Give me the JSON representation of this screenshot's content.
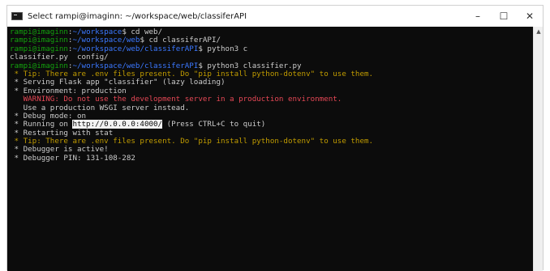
{
  "window": {
    "title": "Select rampi@imaginn: ~/workspace/web/classiferAPI",
    "minimize": "–",
    "maximize": "☐",
    "close": "✕"
  },
  "scrollbar": {
    "up_arrow": "▲"
  },
  "terminal": {
    "lines": [
      [
        {
          "t": "rampi@imaginn",
          "c": "green"
        },
        {
          "t": ":",
          "c": "white"
        },
        {
          "t": "~/workspace",
          "c": "blue"
        },
        {
          "t": "$ cd web/",
          "c": "white"
        }
      ],
      [
        {
          "t": "rampi@imaginn",
          "c": "green"
        },
        {
          "t": ":",
          "c": "white"
        },
        {
          "t": "~/workspace/web",
          "c": "blue"
        },
        {
          "t": "$ cd classiferAPI/",
          "c": "white"
        }
      ],
      [
        {
          "t": "rampi@imaginn",
          "c": "green"
        },
        {
          "t": ":",
          "c": "white"
        },
        {
          "t": "~/workspace/web/classiferAPI",
          "c": "blue"
        },
        {
          "t": "$ python3 c",
          "c": "white"
        }
      ],
      [
        {
          "t": "classifier.py  config/",
          "c": "white"
        }
      ],
      [
        {
          "t": "rampi@imaginn",
          "c": "green"
        },
        {
          "t": ":",
          "c": "white"
        },
        {
          "t": "~/workspace/web/classiferAPI",
          "c": "blue"
        },
        {
          "t": "$ python3 classifier.py",
          "c": "white"
        }
      ],
      [
        {
          "t": " * Tip: There are .env files present. Do \"pip install python-dotenv\" to use them.",
          "c": "yellow"
        }
      ],
      [
        {
          "t": " * Serving Flask app \"classifier\" (lazy loading)",
          "c": "white"
        }
      ],
      [
        {
          "t": " * Environment: production",
          "c": "white"
        }
      ],
      [
        {
          "t": "   WARNING: Do not use the development server in a production environment.",
          "c": "red"
        }
      ],
      [
        {
          "t": "   Use a production WSGI server instead.",
          "c": "white"
        }
      ],
      [
        {
          "t": " * Debug mode: on",
          "c": "white"
        }
      ],
      [
        {
          "t": " * Running on ",
          "c": "white"
        },
        {
          "t": "http://0.0.0.0:4000/",
          "c": "hl"
        },
        {
          "t": " (Press CTRL+C to quit)",
          "c": "white"
        }
      ],
      [
        {
          "t": " * Restarting with stat",
          "c": "white"
        }
      ],
      [
        {
          "t": " * Tip: There are .env files present. Do \"pip install python-dotenv\" to use them.",
          "c": "yellow"
        }
      ],
      [
        {
          "t": " * Debugger is active!",
          "c": "white"
        }
      ],
      [
        {
          "t": " * Debugger PIN: 131-108-282",
          "c": "white"
        }
      ]
    ]
  }
}
